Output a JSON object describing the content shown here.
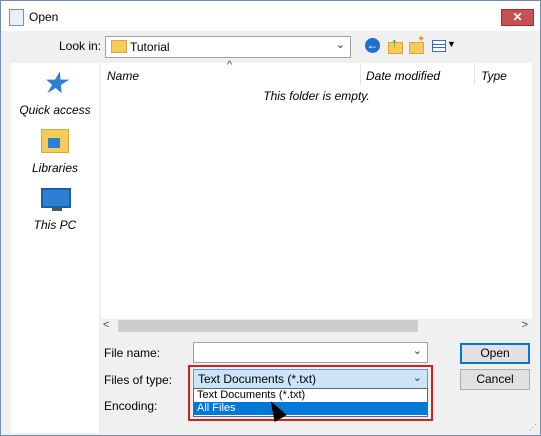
{
  "window": {
    "title": "Open",
    "close_glyph": "✕"
  },
  "lookin": {
    "label": "Look in:",
    "value": "Tutorial"
  },
  "toolbar": {
    "back_icon": "back-arrow-icon",
    "up_icon": "up-folder-icon",
    "new_folder_icon": "new-folder-icon",
    "view_icon": "view-menu-icon"
  },
  "places": [
    {
      "label": "Quick access",
      "icon": "quick-access-star-icon"
    },
    {
      "label": "Libraries",
      "icon": "libraries-icon"
    },
    {
      "label": "This PC",
      "icon": "this-pc-icon"
    }
  ],
  "list": {
    "columns": [
      "Name",
      "Date modified",
      "Type"
    ],
    "empty_message": "This folder is empty."
  },
  "fields": {
    "filename_label": "File name:",
    "filename_value": "",
    "filetype_label": "Files of type:",
    "filetype_value": "Text Documents (*.txt)",
    "encoding_label": "Encoding:",
    "filetype_options": [
      "Text Documents (*.txt)",
      "All Files"
    ],
    "highlighted_option": "All Files"
  },
  "buttons": {
    "open": "Open",
    "cancel": "Cancel"
  },
  "colors": {
    "selection": "#0078d7",
    "highlight_box": "#d61f1f"
  }
}
